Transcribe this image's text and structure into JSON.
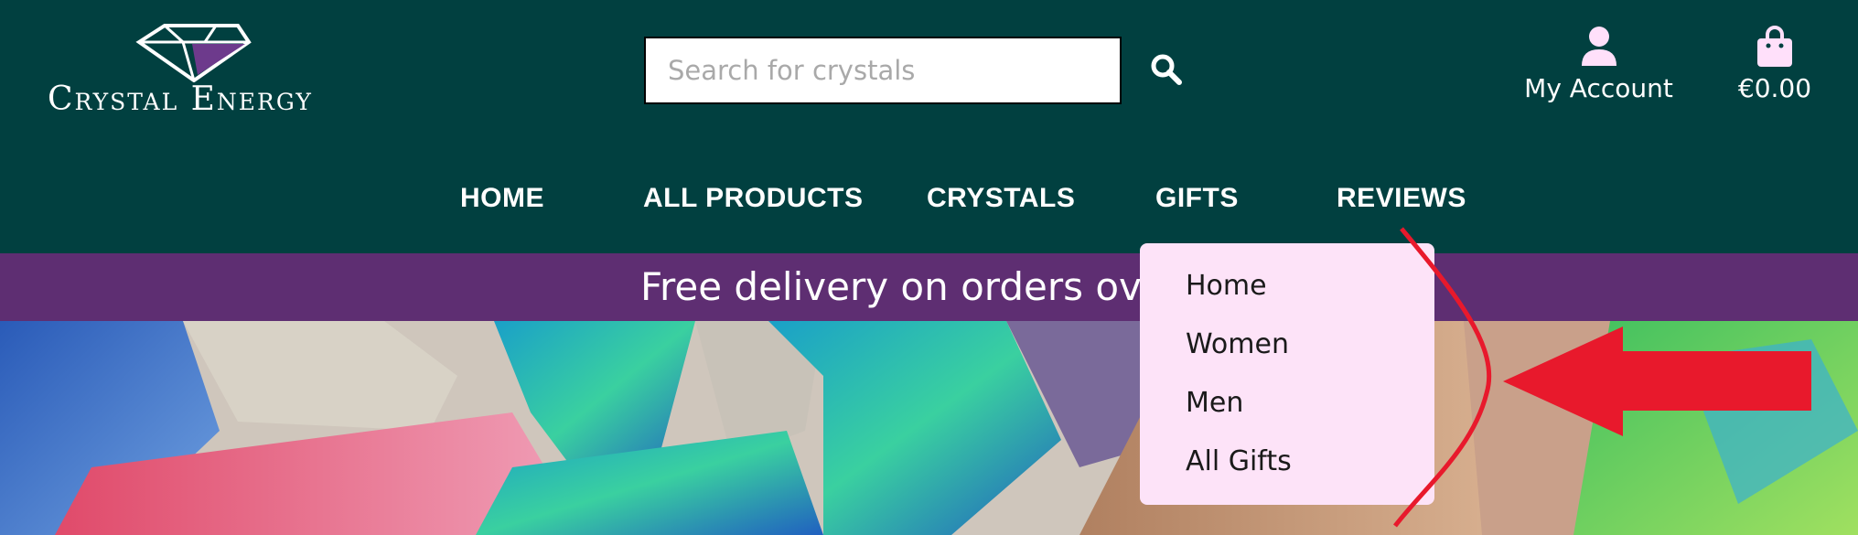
{
  "brand": {
    "name": "Crystal Energy"
  },
  "search": {
    "placeholder": "Search for crystals"
  },
  "account": {
    "label": "My Account"
  },
  "cart": {
    "label": "€0.00"
  },
  "nav": {
    "home": "HOME",
    "all_products": "ALL PRODUCTS",
    "crystals": "CRYSTALS",
    "gifts": "GIFTS",
    "reviews": "REVIEWS"
  },
  "banner": {
    "text": "Free delivery on orders over €"
  },
  "gifts_menu": {
    "items": [
      "Home",
      "Women",
      "Men",
      "All Gifts"
    ]
  },
  "icons": {
    "search": "search-icon",
    "account": "user-icon",
    "cart": "shopping-bag-icon",
    "logo": "gem-icon"
  },
  "colors": {
    "header_bg": "#014040",
    "banner_bg": "#5e2e72",
    "dropdown_bg": "#fde3f8",
    "accent_pink": "#ffe0fa",
    "annotation_red": "#e8192c"
  }
}
